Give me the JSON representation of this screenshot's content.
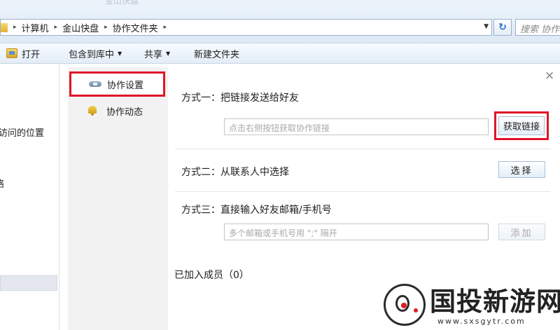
{
  "window": {
    "title_fade": "金山快盘"
  },
  "address_bar": {
    "breadcrumbs": [
      "计算机",
      "金山快盘",
      "协作文件夹"
    ],
    "search_placeholder": "搜索 协作"
  },
  "command_bar": {
    "open_label": "打开",
    "include_label": "包含到库中",
    "share_label": "共享",
    "new_folder_label": "新建文件夹"
  },
  "left_pane": {
    "recent_places_partial": "访问的位置",
    "partial_glyph": "络"
  },
  "dialog": {
    "nav": {
      "settings_label": "协作设置",
      "activity_label": "协作动态"
    },
    "close_glyph": "×",
    "method1": {
      "title": "方式一：把链接发送给好友",
      "input_placeholder": "点击右侧按钮获取协作链接",
      "button_label": "获取链接"
    },
    "method2": {
      "title": "方式二：从联系人中选择",
      "button_label": "选择"
    },
    "method3": {
      "title": "方式三：直接输入好友邮箱/手机号",
      "input_placeholder": "多个邮箱或手机号用 \";\" 隔开",
      "button_label": "添加"
    },
    "members_label": "已加入成员（0）"
  },
  "watermark": {
    "brand": "国投新游网",
    "url": "www.sxsgytr.com"
  },
  "colors": {
    "highlight_red": "#e0142a",
    "toolbar_blue": "#dde9f5",
    "nav_bg": "#f2f2f2"
  }
}
